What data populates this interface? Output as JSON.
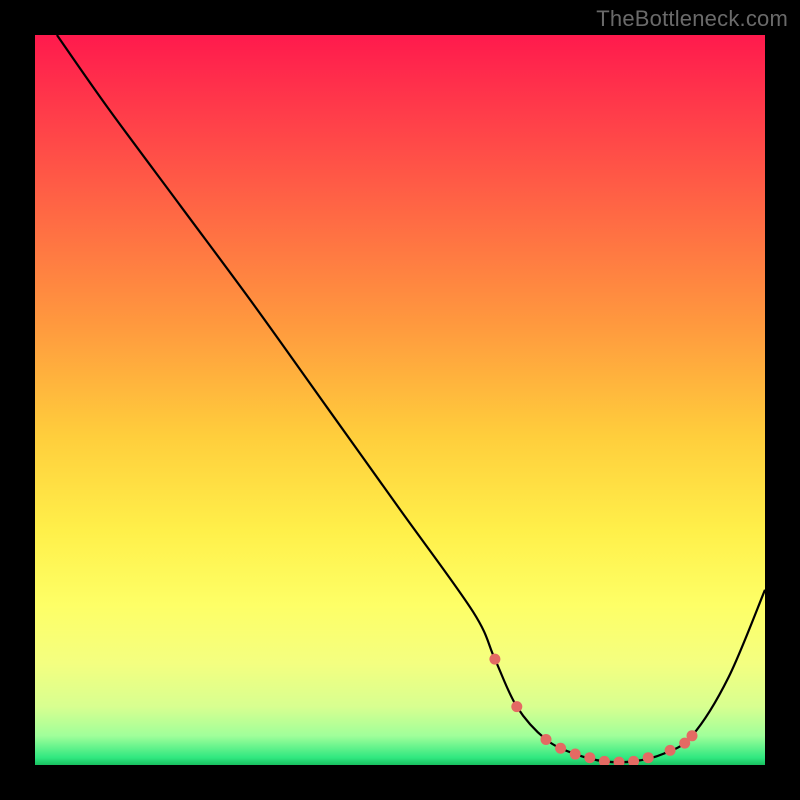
{
  "watermark": "TheBottleneck.com",
  "chart_data": {
    "type": "line",
    "title": "",
    "xlabel": "",
    "ylabel": "",
    "xlim": [
      0,
      100
    ],
    "ylim": [
      0,
      100
    ],
    "annotations": [],
    "series": [
      {
        "name": "bottleneck-curve",
        "x": [
          3,
          10,
          20,
          30,
          40,
          50,
          60,
          63,
          66,
          70,
          74,
          78,
          82,
          86,
          90,
          95,
          100
        ],
        "y": [
          100,
          90,
          76.5,
          63,
          49,
          35,
          21,
          14.5,
          8,
          3.5,
          1.5,
          0.5,
          0.5,
          1.5,
          4,
          12,
          24
        ]
      }
    ],
    "markers": {
      "name": "highlight-dots",
      "x": [
        63,
        66,
        70,
        72,
        74,
        76,
        78,
        80,
        82,
        84,
        87,
        89,
        90
      ],
      "y": [
        14.5,
        8,
        3.5,
        2.3,
        1.5,
        1.0,
        0.5,
        0.4,
        0.5,
        1.0,
        2.0,
        3.0,
        4.0
      ]
    },
    "colors": {
      "curve": "#000000",
      "marker": "#e46a63",
      "gradient_top": "#ff1a4d",
      "gradient_bottom": "#18c060"
    }
  }
}
